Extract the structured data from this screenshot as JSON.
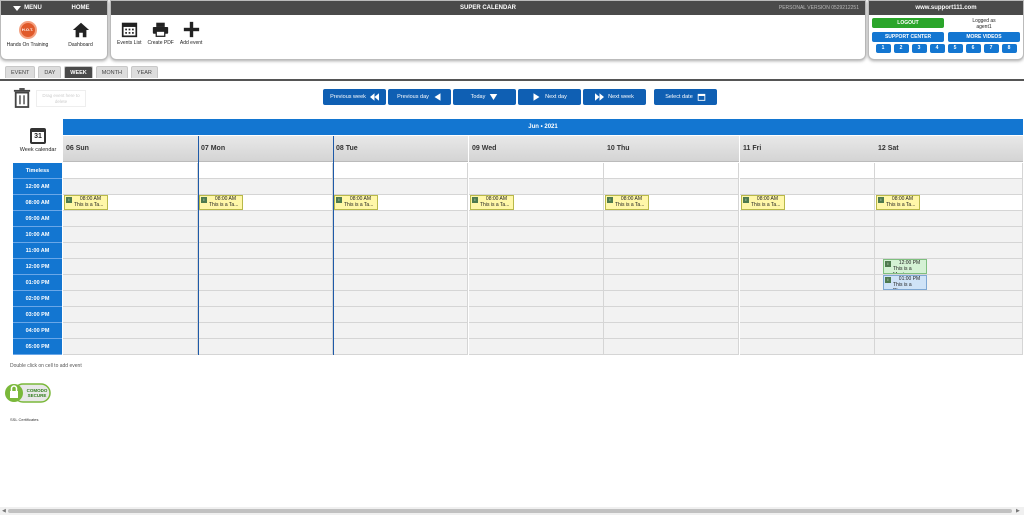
{
  "menu": {
    "title": "MENU",
    "home": "HOME",
    "items": [
      {
        "label": "Hands On Training",
        "icon": "hot-icon",
        "badge": "H.O.T."
      },
      {
        "label": "Dashboard",
        "icon": "home-icon"
      }
    ]
  },
  "app": {
    "title": "SUPER CALENDAR",
    "version": "PERSONAL VERSION 0529212251"
  },
  "toolbar": [
    {
      "label": "Events List",
      "icon": "calendar-list-icon"
    },
    {
      "label": "Create PDF",
      "icon": "printer-icon"
    },
    {
      "label": "Add event",
      "icon": "plus-icon"
    }
  ],
  "account": {
    "site": "www.support111.com",
    "logout": "LOGOUT",
    "logged_as": "Logged as",
    "user": "agent1",
    "support_center": "SUPPORT CENTER",
    "more_videos": "MORE VIDEOS",
    "pages": [
      "1",
      "2",
      "3",
      "4",
      "5",
      "6",
      "7",
      "8"
    ]
  },
  "tabs": [
    {
      "label": "EVENT"
    },
    {
      "label": "DAY"
    },
    {
      "label": "WEEK",
      "active": true
    },
    {
      "label": "MONTH"
    },
    {
      "label": "YEAR"
    }
  ],
  "trash_hint": "Drag event here to delete",
  "nav": {
    "prev_week": "Previous week",
    "prev_day": "Previous day",
    "today": "Today",
    "next_day": "Next day",
    "next_week": "Next week",
    "select_date": "Select date"
  },
  "calendar": {
    "week_label": "Week calendar",
    "week_icon_day": "31",
    "month": "Jun  •  2021",
    "days": [
      "06 Sun",
      "07 Mon",
      "08 Tue",
      "09 Wed",
      "10 Thu",
      "11 Fri",
      "12 Sat"
    ],
    "times": [
      "Timeless",
      "12:00 AM",
      "08:00 AM",
      "09:00 AM",
      "10:00 AM",
      "11:00 AM",
      "12:00 PM",
      "01:00 PM",
      "02:00 PM",
      "03:00 PM",
      "04:00 PM",
      "05:00 PM"
    ],
    "events": [
      {
        "day": 0,
        "time": "08:00 AM",
        "title": "This is a Ta...",
        "color": "yellow"
      },
      {
        "day": 1,
        "time": "08:00 AM",
        "title": "This is a Ta...",
        "color": "yellow"
      },
      {
        "day": 2,
        "time": "08:00 AM",
        "title": "This is a Ta...",
        "color": "yellow"
      },
      {
        "day": 3,
        "time": "08:00 AM",
        "title": "This is a Ta...",
        "color": "yellow"
      },
      {
        "day": 4,
        "time": "08:00 AM",
        "title": "This is a Ta...",
        "color": "yellow"
      },
      {
        "day": 5,
        "time": "08:00 AM",
        "title": "This is a Ta...",
        "color": "yellow"
      },
      {
        "day": 6,
        "time": "08:00 AM",
        "title": "This is a Ta...",
        "color": "yellow"
      },
      {
        "day": 6,
        "time": "12:00 PM",
        "title": "This is a Meet...",
        "color": "green"
      },
      {
        "day": 6,
        "time": "01:00 PM",
        "title": "This is a Phon...",
        "color": "blue"
      }
    ]
  },
  "footnote": "Double click on cell to add event",
  "secure_badge": {
    "top": "COMODO",
    "bottom": "SECURE"
  },
  "ssl": "SSL Certificates"
}
